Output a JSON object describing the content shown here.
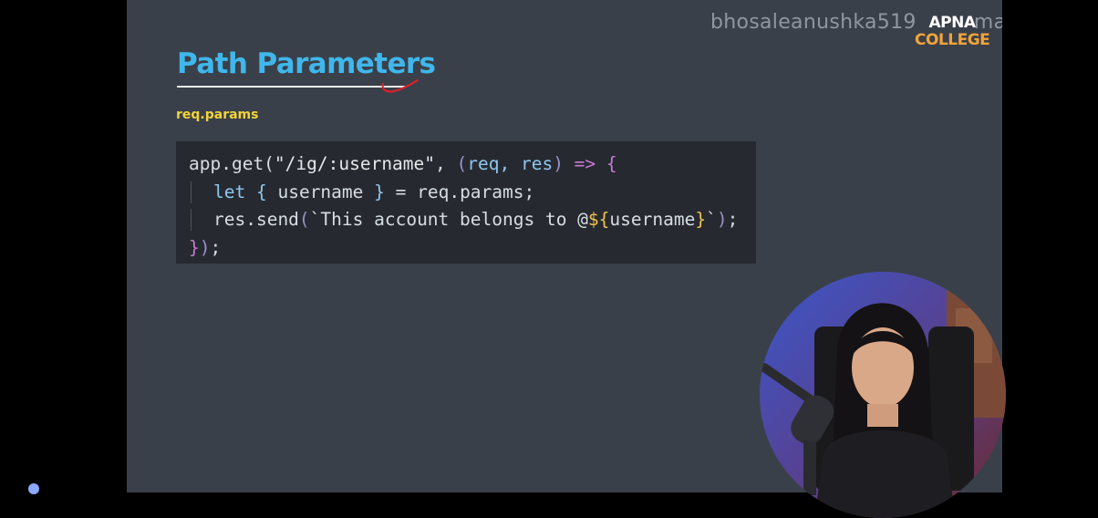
{
  "watermark": {
    "email": "bhosaleanushka519",
    "email_tail": "mail.com",
    "logo_line1": "APNA",
    "logo_line2": "COLLEGE"
  },
  "slide": {
    "title": "Path Parameters",
    "subtitle": "req.params"
  },
  "code": {
    "line1": {
      "a": "app.get(",
      "b": "\"/ig/:username\"",
      "c": ", ",
      "d": "(",
      "e": "req, res",
      "f": ")",
      "g": " => ",
      "h": "{"
    },
    "line2": {
      "a": "let",
      "b": " ",
      "c": "{",
      "d": " username ",
      "e": "}",
      "f": " = req.params;"
    },
    "line3": {
      "a": "res.send",
      "b": "(",
      "c": "`This account belongs to @",
      "d": "${",
      "e": "username",
      "f": "}",
      "g": "`",
      "h": ")",
      "i": ";"
    },
    "line4": {
      "a": "}",
      "b": ")",
      "c": ";"
    }
  },
  "colors": {
    "slide_background": "#3a4049",
    "title": "#3fb7ec",
    "subtitle": "#f2d33a",
    "code_background": "#262a30",
    "logo_accent": "#f2a33a"
  }
}
